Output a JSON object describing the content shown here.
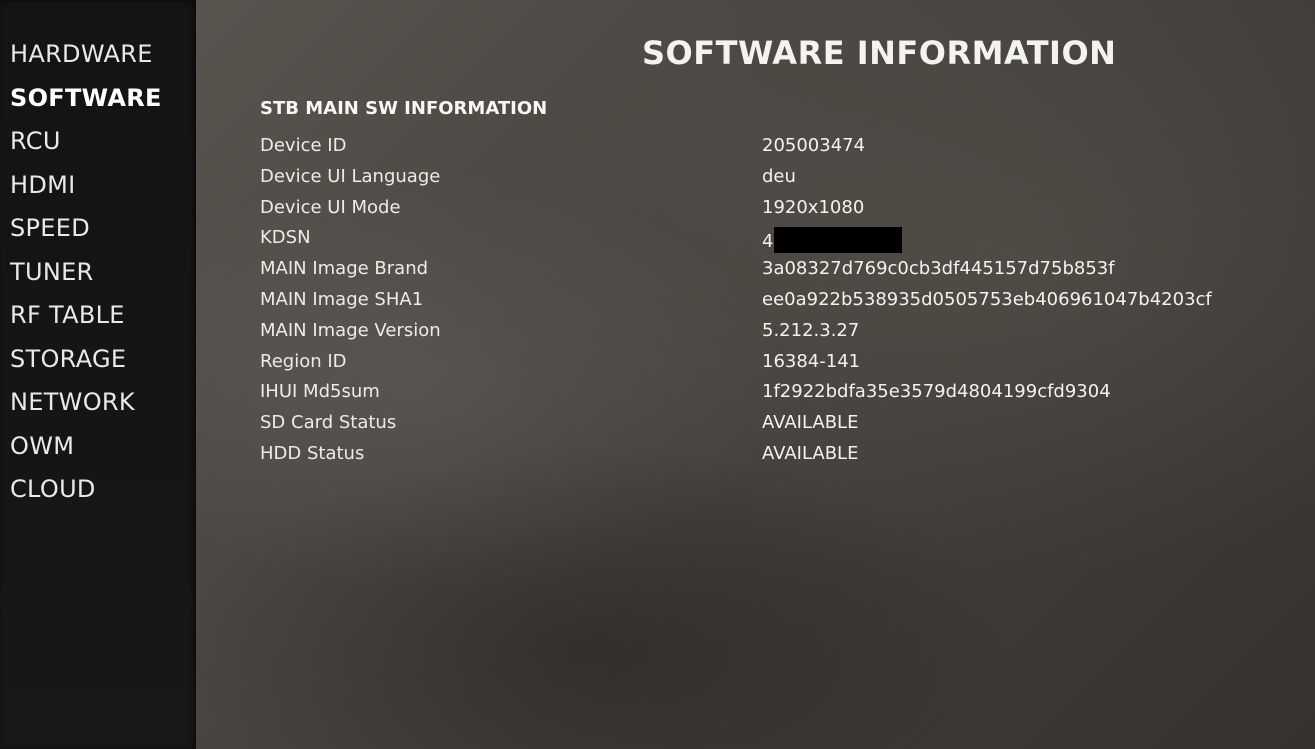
{
  "sidebar": {
    "items": [
      {
        "label": "HARDWARE",
        "active": false
      },
      {
        "label": "SOFTWARE",
        "active": true
      },
      {
        "label": "RCU",
        "active": false
      },
      {
        "label": "HDMI",
        "active": false
      },
      {
        "label": "SPEED",
        "active": false
      },
      {
        "label": "TUNER",
        "active": false
      },
      {
        "label": "RF TABLE",
        "active": false
      },
      {
        "label": "STORAGE",
        "active": false
      },
      {
        "label": "NETWORK",
        "active": false
      },
      {
        "label": "OWM",
        "active": false
      },
      {
        "label": "CLOUD",
        "active": false
      }
    ]
  },
  "main": {
    "title": "SOFTWARE INFORMATION",
    "section_title": "STB MAIN SW INFORMATION",
    "rows": [
      {
        "label": "Device ID",
        "value": "205003474"
      },
      {
        "label": "Device UI Language",
        "value": "deu"
      },
      {
        "label": "Device UI Mode",
        "value": "1920x1080"
      },
      {
        "label": "KDSN",
        "value": "4",
        "redacted": true
      },
      {
        "label": "MAIN Image Brand",
        "value": "3a08327d769c0cb3df445157d75b853f"
      },
      {
        "label": "MAIN Image SHA1",
        "value": "ee0a922b538935d0505753eb406961047b4203cf"
      },
      {
        "label": "MAIN Image Version",
        "value": "5.212.3.27"
      },
      {
        "label": "Region ID",
        "value": "16384-141"
      },
      {
        "label": "IHUI Md5sum",
        "value": "1f2922bdfa35e3579d4804199cfd9304"
      },
      {
        "label": "SD Card Status",
        "value": "AVAILABLE"
      },
      {
        "label": "HDD Status",
        "value": "AVAILABLE"
      }
    ]
  }
}
